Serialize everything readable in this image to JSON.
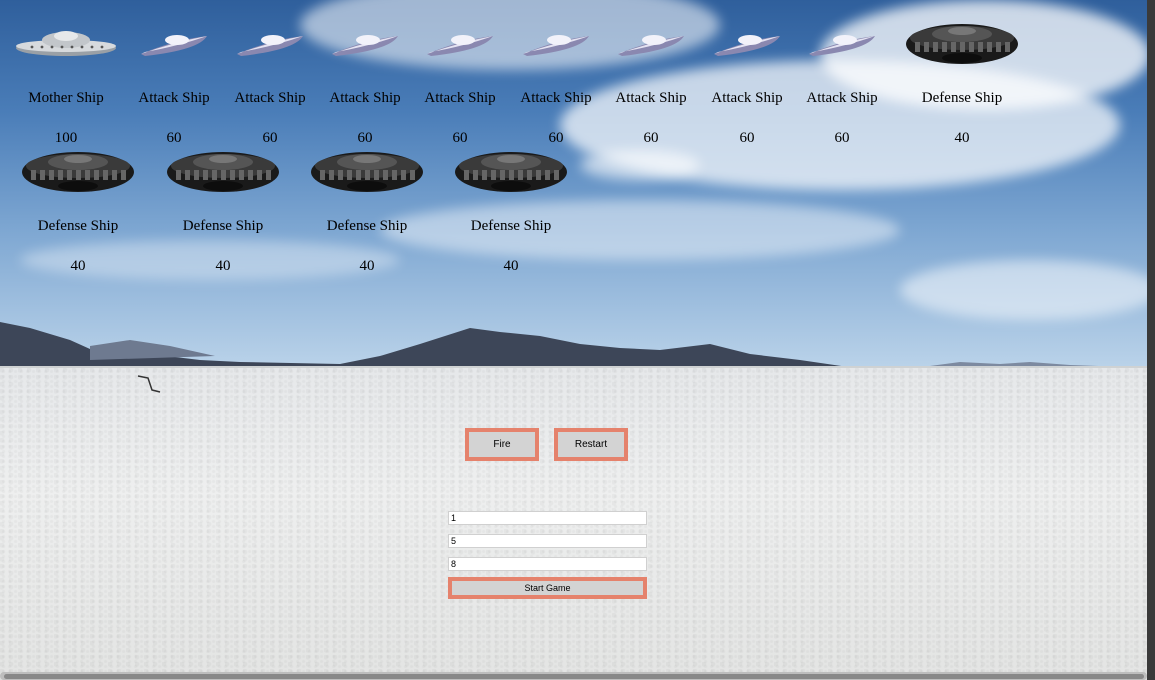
{
  "ships": [
    {
      "name": "Mother Ship",
      "hp": "100",
      "kind": "mother"
    },
    {
      "name": "Attack Ship",
      "hp": "60",
      "kind": "attack"
    },
    {
      "name": "Attack Ship",
      "hp": "60",
      "kind": "attack"
    },
    {
      "name": "Attack Ship",
      "hp": "60",
      "kind": "attack"
    },
    {
      "name": "Attack Ship",
      "hp": "60",
      "kind": "attack"
    },
    {
      "name": "Attack Ship",
      "hp": "60",
      "kind": "attack"
    },
    {
      "name": "Attack Ship",
      "hp": "60",
      "kind": "attack"
    },
    {
      "name": "Attack Ship",
      "hp": "60",
      "kind": "attack"
    },
    {
      "name": "Attack Ship",
      "hp": "60",
      "kind": "attack"
    },
    {
      "name": "Defense Ship",
      "hp": "40",
      "kind": "defense"
    },
    {
      "name": "Defense Ship",
      "hp": "40",
      "kind": "defense"
    },
    {
      "name": "Defense Ship",
      "hp": "40",
      "kind": "defense"
    },
    {
      "name": "Defense Ship",
      "hp": "40",
      "kind": "defense"
    },
    {
      "name": "Defense Ship",
      "hp": "40",
      "kind": "defense"
    }
  ],
  "controls": {
    "fire_label": "Fire",
    "restart_label": "Restart"
  },
  "setup": {
    "mother_count": "1",
    "attack_count": "5",
    "defense_count": "8",
    "start_label": "Start Game"
  },
  "colors": {
    "button_border": "#e5826c",
    "button_fill": "#d3d3d3"
  },
  "icons": {
    "mother": "mother-ship-icon",
    "attack": "attack-ship-icon",
    "defense": "defense-ship-icon"
  }
}
